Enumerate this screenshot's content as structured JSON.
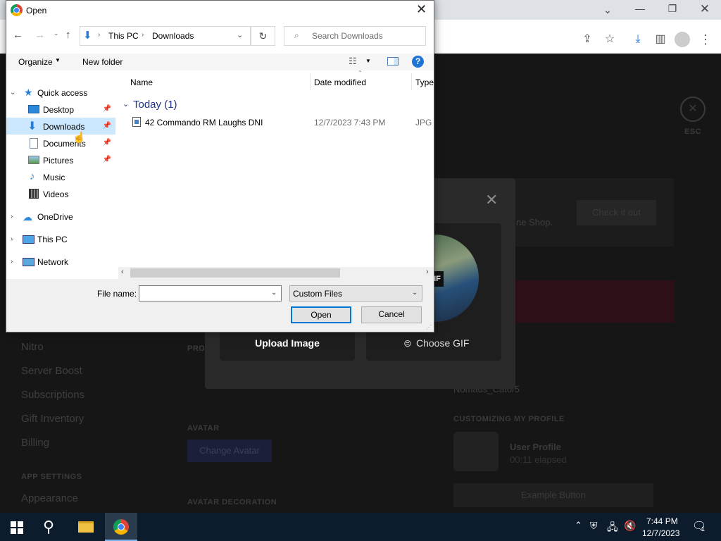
{
  "dialog": {
    "title": "Open",
    "address": {
      "items": [
        "This PC",
        "Downloads"
      ]
    },
    "search_placeholder": "Search Downloads",
    "organize_label": "Organize",
    "new_folder_label": "New folder",
    "columns": {
      "name": "Name",
      "date": "Date modified",
      "type": "Type"
    },
    "group_label": "Today (1)",
    "files": [
      {
        "name": "42 Commando RM Laughs DNI",
        "date": "12/7/2023 7:43 PM",
        "type": "JPG F"
      }
    ],
    "nav": {
      "quick_access": "Quick access",
      "items": [
        "Desktop",
        "Downloads",
        "Documents",
        "Pictures",
        "Music",
        "Videos"
      ],
      "onedrive": "OneDrive",
      "this_pc": "This PC",
      "network": "Network"
    },
    "filename_label": "File name:",
    "filename_value": "",
    "filetype_value": "Custom Files",
    "open_button": "Open",
    "cancel_button": "Cancel"
  },
  "discord": {
    "sidebar_items": [
      "Nitro",
      "Server Boost",
      "Subscriptions",
      "Gift Inventory",
      "Billing"
    ],
    "app_settings": "APP SETTINGS",
    "appearance": "Appearance",
    "avatar_header": "AVATAR",
    "change_avatar": "Change Avatar",
    "avatar_decoration": "AVATAR DECORATION",
    "customizing": "CUSTOMIZING MY PROFILE",
    "user_profile": "User Profile",
    "elapsed": "00:11 elapsed",
    "example_button": "Example Button",
    "username": "Nomads_Cat0/5",
    "check_it_out": "Check it out",
    "shop_text": "ne Shop.",
    "esc": "ESC",
    "upload_image": "Upload Image",
    "choose_gif": "Choose GIF",
    "gif_badge": "IF",
    "pro_label": "PRO"
  },
  "taskbar": {
    "time": "7:44 PM",
    "date": "12/7/2023",
    "notification_count": "1"
  },
  "colors": {
    "accent": "#0078d7",
    "selection": "#cce8ff",
    "taskbar": "#0d1c2d"
  }
}
